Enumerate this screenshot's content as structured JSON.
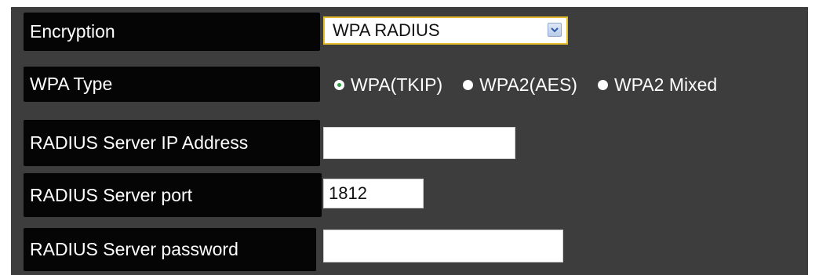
{
  "form": {
    "encryption": {
      "label": "Encryption",
      "selected_value": "WPA RADIUS"
    },
    "wpa_type": {
      "label": "WPA Type",
      "options": [
        {
          "label": "WPA(TKIP)",
          "selected": true
        },
        {
          "label": "WPA2(AES)",
          "selected": false
        },
        {
          "label": "WPA2 Mixed",
          "selected": false
        }
      ]
    },
    "radius_ip": {
      "label": "RADIUS Server IP Address",
      "value": ""
    },
    "radius_port": {
      "label": "RADIUS Server port",
      "value": "1812"
    },
    "radius_password": {
      "label": "RADIUS Server password",
      "value": ""
    }
  },
  "colors": {
    "panel_background": "#3d3d3d",
    "label_background": "#050505",
    "select_border": "#e6bd2c",
    "selected_radio": "#2ea043"
  }
}
